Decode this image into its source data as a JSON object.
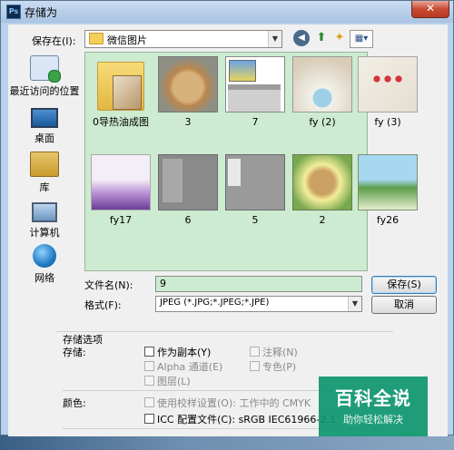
{
  "window": {
    "title": "存储为",
    "app_badge": "Ps",
    "close_glyph": "✕"
  },
  "save_in": {
    "label": "保存在(I):",
    "value": "微信图片"
  },
  "toolbar": {
    "icons": [
      "back-icon",
      "up-folder-icon",
      "new-folder-icon",
      "view-menu-icon"
    ]
  },
  "places": [
    {
      "label": "最近访问的位置",
      "icon": "recent-places-icon"
    },
    {
      "label": "桌面",
      "icon": "desktop-icon"
    },
    {
      "label": "库",
      "icon": "libraries-icon"
    },
    {
      "label": "计算机",
      "icon": "computer-icon"
    },
    {
      "label": "网络",
      "icon": "network-icon"
    }
  ],
  "files": [
    {
      "name": "0导热油成图",
      "kind": "folder"
    },
    {
      "name": "3",
      "kind": "image"
    },
    {
      "name": "7",
      "kind": "image"
    },
    {
      "name": "fy (2)",
      "kind": "image"
    },
    {
      "name": "fy (3)",
      "kind": "image"
    },
    {
      "name": "fy17",
      "kind": "image"
    },
    {
      "name": "6",
      "kind": "image"
    },
    {
      "name": "5",
      "kind": "image"
    },
    {
      "name": "2",
      "kind": "image"
    },
    {
      "name": "fy26",
      "kind": "image"
    }
  ],
  "file_name": {
    "label": "文件名(N):",
    "value": "9"
  },
  "file_type": {
    "label": "格式(F):",
    "value": "JPEG (*.JPG;*.JPEG;*.JPE)"
  },
  "buttons": {
    "save": "保存(S)",
    "cancel": "取消"
  },
  "options": {
    "group_title": "存储选项",
    "save_label": "存储:",
    "as_copy": "作为副本(Y)",
    "annotations": "注释(N)",
    "alpha": "Alpha 通道(E)",
    "spot": "专色(P)",
    "layers": "图层(L)",
    "color_label": "颜色:",
    "proof": "使用校样设置(O): 工作中的 CMYK",
    "icc": "ICC 配置文件(C): sRGB IEC61966-2.1"
  },
  "watermark": {
    "main": "百科全说",
    "sub": "助你轻松解决"
  }
}
